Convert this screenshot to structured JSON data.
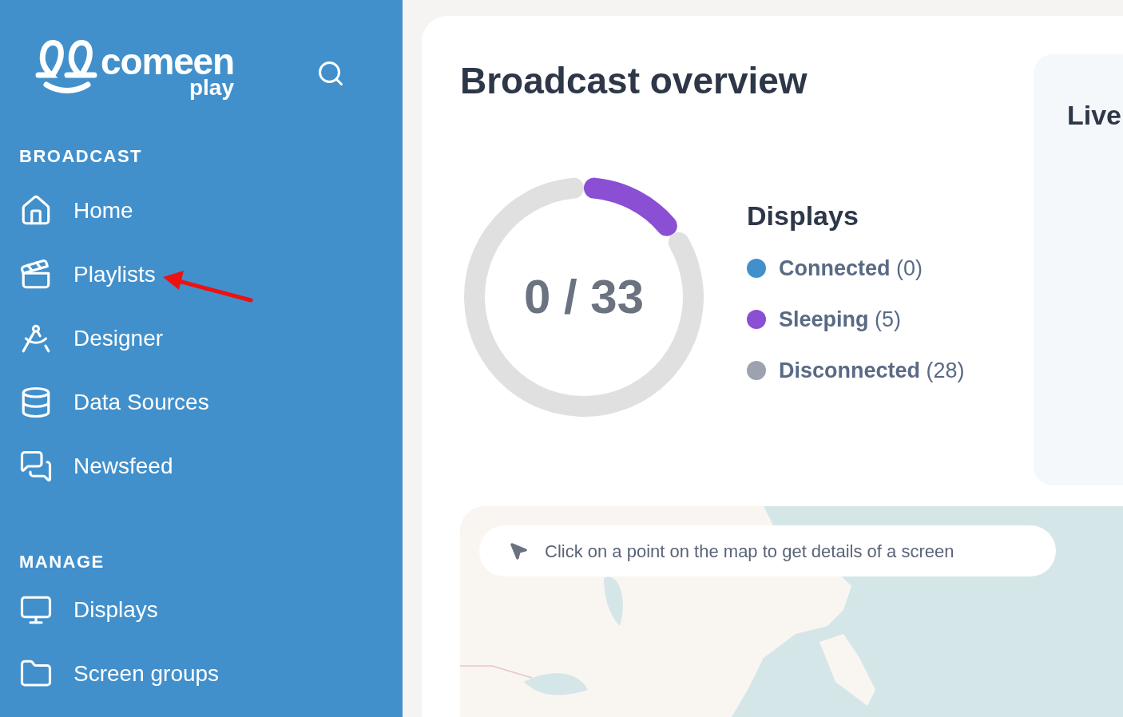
{
  "sidebar": {
    "logo": {
      "name": "comeen",
      "sub": "play"
    },
    "sections": [
      {
        "title": "BROADCAST",
        "items": [
          {
            "label": "Home"
          },
          {
            "label": "Playlists"
          },
          {
            "label": "Designer"
          },
          {
            "label": "Data Sources"
          },
          {
            "label": "Newsfeed"
          }
        ]
      },
      {
        "title": "MANAGE",
        "items": [
          {
            "label": "Displays"
          },
          {
            "label": "Screen groups"
          }
        ]
      }
    ]
  },
  "main": {
    "title": "Broadcast overview",
    "displays": {
      "center_label": "0 / 33",
      "legend": [
        {
          "count": "(0)",
          "color": "#4190cc"
        },
        {
          "count": "(5)",
          "color": "#8a4fd3"
        },
        {
          "count": "(28)",
          "color": "#9ca3af"
        }
      ],
      "chart_data": {
        "type": "donut",
        "categories": [
          "Connected",
          "Sleeping",
          "Disconnected"
        ],
        "series": [
          {
            "name": "Displays",
            "values": [
              0,
              15.2,
              84.8
            ]
          }
        ]
      }
    },
    "side_panel": {
      "title": "Live"
    },
    "map": {
      "hint": "Click on a point on the map to get details of a screen"
    }
  }
}
